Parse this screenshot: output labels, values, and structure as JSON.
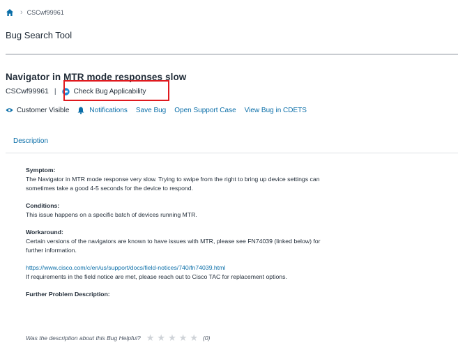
{
  "breadcrumb": {
    "home_icon": "home-icon",
    "current": "CSCwf99961"
  },
  "app_title": "Bug Search Tool",
  "bug": {
    "title": "Navigator in MTR mode responses slow",
    "id": "CSCwf99961",
    "separator": "|",
    "check_label": "Check Bug Applicability"
  },
  "actions": {
    "customer_visible": "Customer Visible",
    "notifications": "Notifications",
    "save_bug": "Save Bug",
    "open_support_case": "Open Support Case",
    "view_cdets": "View Bug in CDETS"
  },
  "tabs": {
    "description": "Description"
  },
  "content": {
    "symptom_heading": "Symptom:",
    "symptom_line1": "The Navigator in MTR mode response very slow. Trying to swipe from the right to bring up device settings can",
    "symptom_line2": "sometimes take a good 4-5 seconds for the device to respond.",
    "conditions_heading": "Conditions:",
    "conditions_text": "This issue happens on a specific batch of devices running MTR.",
    "workaround_heading": "Workaround:",
    "workaround_line1": "Certain versions of the navigators are known to have issues with MTR, please see FN74039 (linked below) for",
    "workaround_line2": "further information.",
    "link": "https://www.cisco.com/c/en/us/support/docs/field-notices/740/fn74039.html",
    "link_followup": "If requirements in the field notice are met, please reach out to Cisco TAC for replacement options.",
    "further_heading": "Further Problem Description:"
  },
  "rating": {
    "question": "Was the description about this Bug Helpful?",
    "count": "(0)",
    "max_stars": 5,
    "value": 0
  },
  "colors": {
    "link": "#0a6ea8",
    "highlight": "#e0191e",
    "text": "#1f2a36"
  }
}
